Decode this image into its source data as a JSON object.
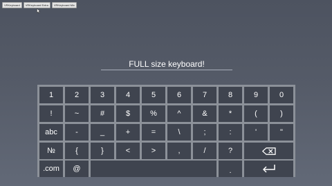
{
  "tabs": [
    {
      "label": "VRKeyboard"
    },
    {
      "label": "VRKeyboard Extra"
    },
    {
      "label": "VRKeyboard Mix"
    }
  ],
  "input": {
    "value": "FULL size keyboard!"
  },
  "keyboard": {
    "rows": [
      [
        "1",
        "2",
        "3",
        "4",
        "5",
        "6",
        "7",
        "8",
        "9",
        "0"
      ],
      [
        "!",
        "~",
        "#",
        "$",
        "%",
        "^",
        "&",
        "*",
        "(",
        ")"
      ],
      [
        "abc",
        "-",
        "_",
        "+",
        "=",
        "\\",
        ";",
        ":",
        "'",
        "\""
      ],
      [
        "№",
        "{",
        "}",
        "<",
        ">",
        ",",
        "/",
        "?"
      ],
      [
        ".com",
        "@",
        "."
      ]
    ],
    "backspace_icon": "backspace-icon",
    "enter_icon": "enter-arrow-icon",
    "space_label": ""
  },
  "colors": {
    "key_background": "#3f444f",
    "keyboard_border": "#8c9199",
    "key_text": "#ffffff"
  }
}
